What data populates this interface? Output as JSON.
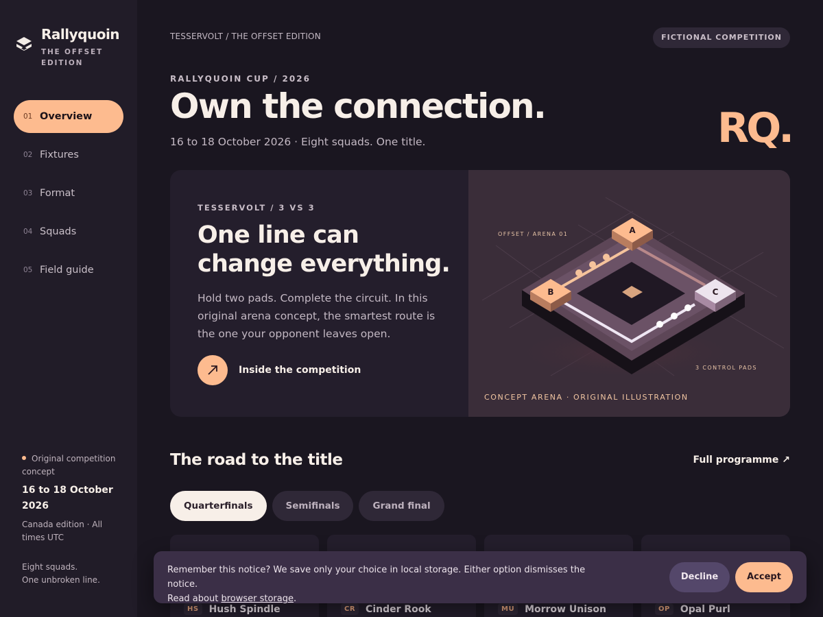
{
  "brand": {
    "name": "Rallyquoin",
    "subtitle": "THE OFFSET EDITION",
    "logo_icon": "layered-diamond-icon"
  },
  "nav": [
    {
      "num": "01",
      "label": "Overview",
      "active": true
    },
    {
      "num": "02",
      "label": "Fixtures",
      "active": false
    },
    {
      "num": "03",
      "label": "Format",
      "active": false
    },
    {
      "num": "04",
      "label": "Squads",
      "active": false
    },
    {
      "num": "05",
      "label": "Field guide",
      "active": false
    }
  ],
  "side_info": {
    "tag": "Original competition concept",
    "date": "16 to 18 October 2026",
    "meta": "Canada edition · All times UTC",
    "motto_line1": "Eight squads.",
    "motto_line2": "One unbroken line."
  },
  "header": {
    "breadcrumb": "TESSERVOLT / THE OFFSET EDITION",
    "badge": "FICTIONAL COMPETITION",
    "eyebrow": "RALLYQUOIN CUP / 2026",
    "title": "Own the connection.",
    "subtitle": "16 to 18 October 2026 · Eight squads. One title.",
    "monogram": "RQ."
  },
  "feature": {
    "eyebrow": "TESSERVOLT / 3 VS 3",
    "title_line1": "One line can",
    "title_line2": "change everything.",
    "body": "Hold two pads. Complete the circuit. In this original arena concept, the smartest route is the one your opponent leaves open.",
    "cta_label": "Inside the competition",
    "cta_icon": "arrow-up-right-icon",
    "arena": {
      "top_label": "OFFSET / ARENA 01",
      "pads_label": "3 CONTROL PADS",
      "pad_a": "A",
      "pad_b": "B",
      "pad_c": "C",
      "caption": "CONCEPT ARENA · ORIGINAL ILLUSTRATION"
    }
  },
  "road": {
    "title": "The road to the title",
    "link": "Full programme ↗",
    "tabs": [
      {
        "label": "Quarterfinals",
        "active": true
      },
      {
        "label": "Semifinals",
        "active": false
      },
      {
        "label": "Grand final",
        "active": false
      }
    ],
    "fixtures": [
      {
        "abbr": "HS",
        "name": "Hush Spindle"
      },
      {
        "abbr": "CR",
        "name": "Cinder Rook"
      },
      {
        "abbr": "MU",
        "name": "Morrow Unison"
      },
      {
        "abbr": "OP",
        "name": "Opal Purl"
      }
    ]
  },
  "notice": {
    "text": "Remember this notice? We save only your choice in local storage. Either option dismisses the notice.",
    "read_prefix": "Read about ",
    "link": "browser storage",
    "suffix": ".",
    "decline": "Decline",
    "accept": "Accept"
  },
  "colors": {
    "accent": "#fdbb8f",
    "background": "#1a1620",
    "surface": "#241e2c"
  }
}
